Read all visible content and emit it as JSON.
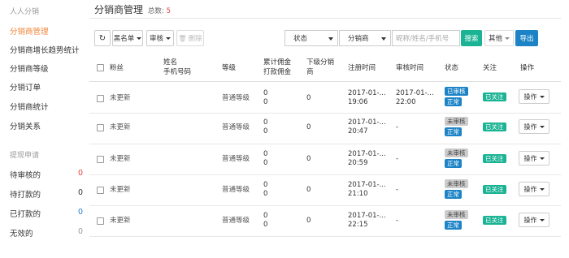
{
  "sidebar": {
    "group1": "人人分销",
    "items": [
      {
        "label": "分销商管理",
        "active": true
      },
      {
        "label": "分销商增长趋势统计"
      },
      {
        "label": "分销商等级"
      },
      {
        "label": "分销订单"
      },
      {
        "label": "分销商统计"
      },
      {
        "label": "分销关系"
      }
    ],
    "group2": "提现申请",
    "withdraw": [
      {
        "label": "待审核的",
        "count": "0"
      },
      {
        "label": "待打款的",
        "count": "0"
      },
      {
        "label": "已打款的",
        "count": "0"
      },
      {
        "label": "无效的",
        "count": "0"
      }
    ]
  },
  "header": {
    "title": "分销商管理",
    "total_label": "总数:",
    "total_count": "5"
  },
  "toolbar": {
    "refresh_icon": "↻",
    "blacklist": "黑名单",
    "audit": "审核",
    "delete": "删除",
    "status_select": "状态",
    "type_select": "分销商",
    "search_placeholder": "昵称/姓名/手机号",
    "search_button": "搜索",
    "other": "其他",
    "export": "导出"
  },
  "table": {
    "headers": {
      "fans": "粉丝",
      "name": "姓名",
      "phone": "手机号码",
      "level": "等级",
      "commission1": "累计佣金",
      "commission2": "打款佣金",
      "downline1": "下级分销",
      "downline2": "商",
      "reg_time": "注册时间",
      "audit_time": "审核时间",
      "status": "状态",
      "follow": "关注",
      "action": "操作"
    },
    "rows": [
      {
        "fans": "未更新",
        "level": "普通等级",
        "c1": "0",
        "c2": "0",
        "down": "0",
        "reg1": "2017-01-...",
        "reg2": "19:06",
        "aud1": "2017-01-...",
        "aud2": "22:00",
        "st1": "已审核",
        "st2": "正常",
        "follow": "已关注",
        "op": "操作"
      },
      {
        "fans": "未更新",
        "level": "普通等级",
        "c1": "0",
        "c2": "0",
        "down": "0",
        "reg1": "2017-01-...",
        "reg2": "20:47",
        "aud1": "-",
        "aud2": "",
        "st1": "未审核",
        "st2": "正常",
        "follow": "已关注",
        "op": "操作"
      },
      {
        "fans": "未更新",
        "level": "普通等级",
        "c1": "0",
        "c2": "0",
        "down": "0",
        "reg1": "2017-01-...",
        "reg2": "20:59",
        "aud1": "-",
        "aud2": "",
        "st1": "未审核",
        "st2": "正常",
        "follow": "已关注",
        "op": "操作"
      },
      {
        "fans": "未更新",
        "level": "普通等级",
        "c1": "0",
        "c2": "0",
        "down": "0",
        "reg1": "2017-01-...",
        "reg2": "21:10",
        "aud1": "-",
        "aud2": "",
        "st1": "未审核",
        "st2": "正常",
        "follow": "已关注",
        "op": "操作"
      },
      {
        "fans": "未更新",
        "level": "普通等级",
        "c1": "0",
        "c2": "0",
        "down": "0",
        "reg1": "2017-01-...",
        "reg2": "22:15",
        "aud1": "-",
        "aud2": "",
        "st1": "未审核",
        "st2": "正常",
        "follow": "已关注",
        "op": "操作"
      }
    ]
  }
}
